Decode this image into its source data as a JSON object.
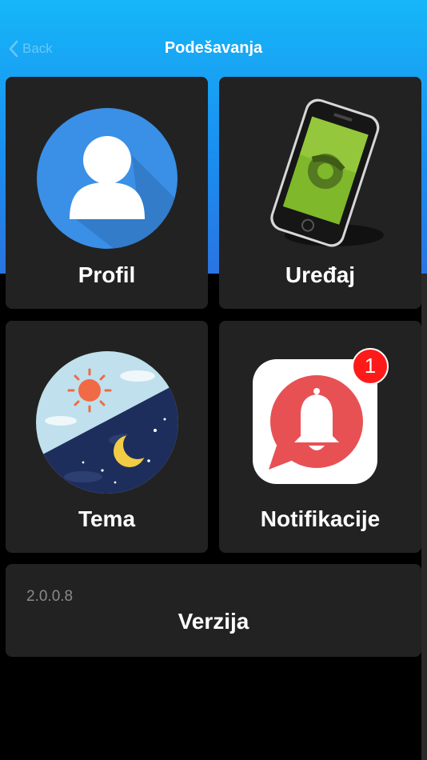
{
  "nav": {
    "back_label": "Back",
    "title": "Podešavanja"
  },
  "tiles": {
    "profil": {
      "label": "Profil",
      "icon": "user-icon"
    },
    "uredjaj": {
      "label": "Uređaj",
      "icon": "phone-icon"
    },
    "tema": {
      "label": "Tema",
      "icon": "day-night-icon"
    },
    "notifikacije": {
      "label": "Notifikacije",
      "icon": "bell-icon",
      "badge": "1"
    }
  },
  "version": {
    "number": "2.0.0.8",
    "label": "Verzija"
  },
  "colors": {
    "header_top": "#16b6f8",
    "header_bottom": "#2a74e0",
    "tile_bg": "#222222",
    "badge": "#ff1a1a",
    "bell_bubble": "#e85154"
  }
}
